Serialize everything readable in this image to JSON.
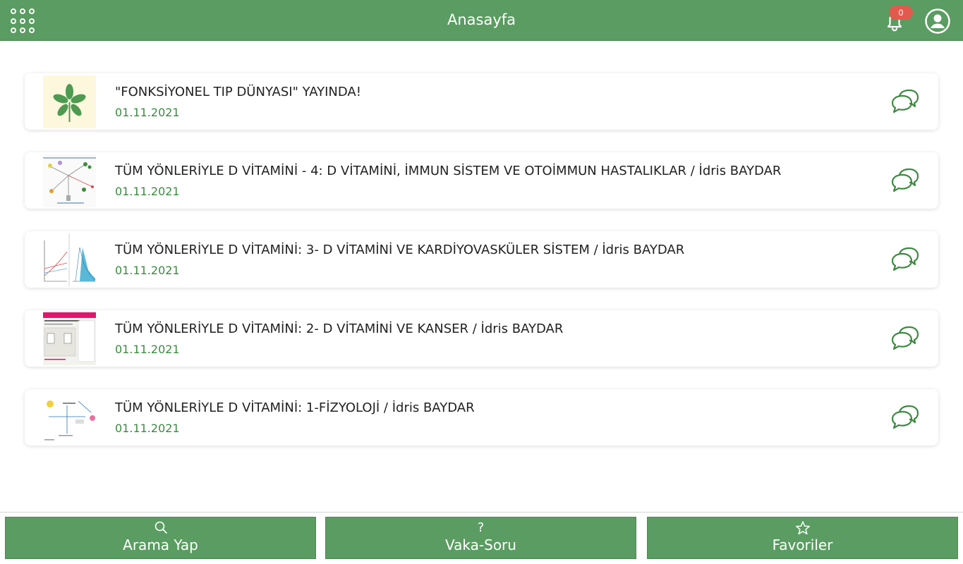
{
  "header": {
    "title": "Anasayfa",
    "notification_count": "0"
  },
  "posts": [
    {
      "title": "\"FONKSİYONEL TIP DÜNYASI\" YAYINDA!",
      "date": "01.11.2021"
    },
    {
      "title": "TÜM YÖNLERİYLE D VİTAMİNİ - 4: D VİTAMİNİ, İMMUN SİSTEM VE OTOİMMUN HASTALIKLAR / İdris BAYDAR",
      "date": "01.11.2021"
    },
    {
      "title": "TÜM YÖNLERİYLE D VİTAMİNİ: 3- D VİTAMİNİ VE KARDİYOVASKÜLER SİSTEM / İdris BAYDAR",
      "date": "01.11.2021"
    },
    {
      "title": "TÜM YÖNLERİYLE D VİTAMİNİ: 2- D VİTAMİNİ VE KANSER / İdris BAYDAR",
      "date": "01.11.2021"
    },
    {
      "title": "TÜM YÖNLERİYLE D VİTAMİNİ: 1-FİZYOLOJİ / İdris BAYDAR",
      "date": "01.11.2021"
    }
  ],
  "bottom_nav": {
    "search": {
      "label": "Arama Yap",
      "icon": "search-icon"
    },
    "case": {
      "label": "Vaka-Soru",
      "icon": "question-icon",
      "glyph": "?"
    },
    "favorites": {
      "label": "Favoriler",
      "icon": "star-outline-icon"
    }
  },
  "colors": {
    "primary": "#5a9c61",
    "date_text": "#3d8a41",
    "badge": "#e2594e"
  }
}
